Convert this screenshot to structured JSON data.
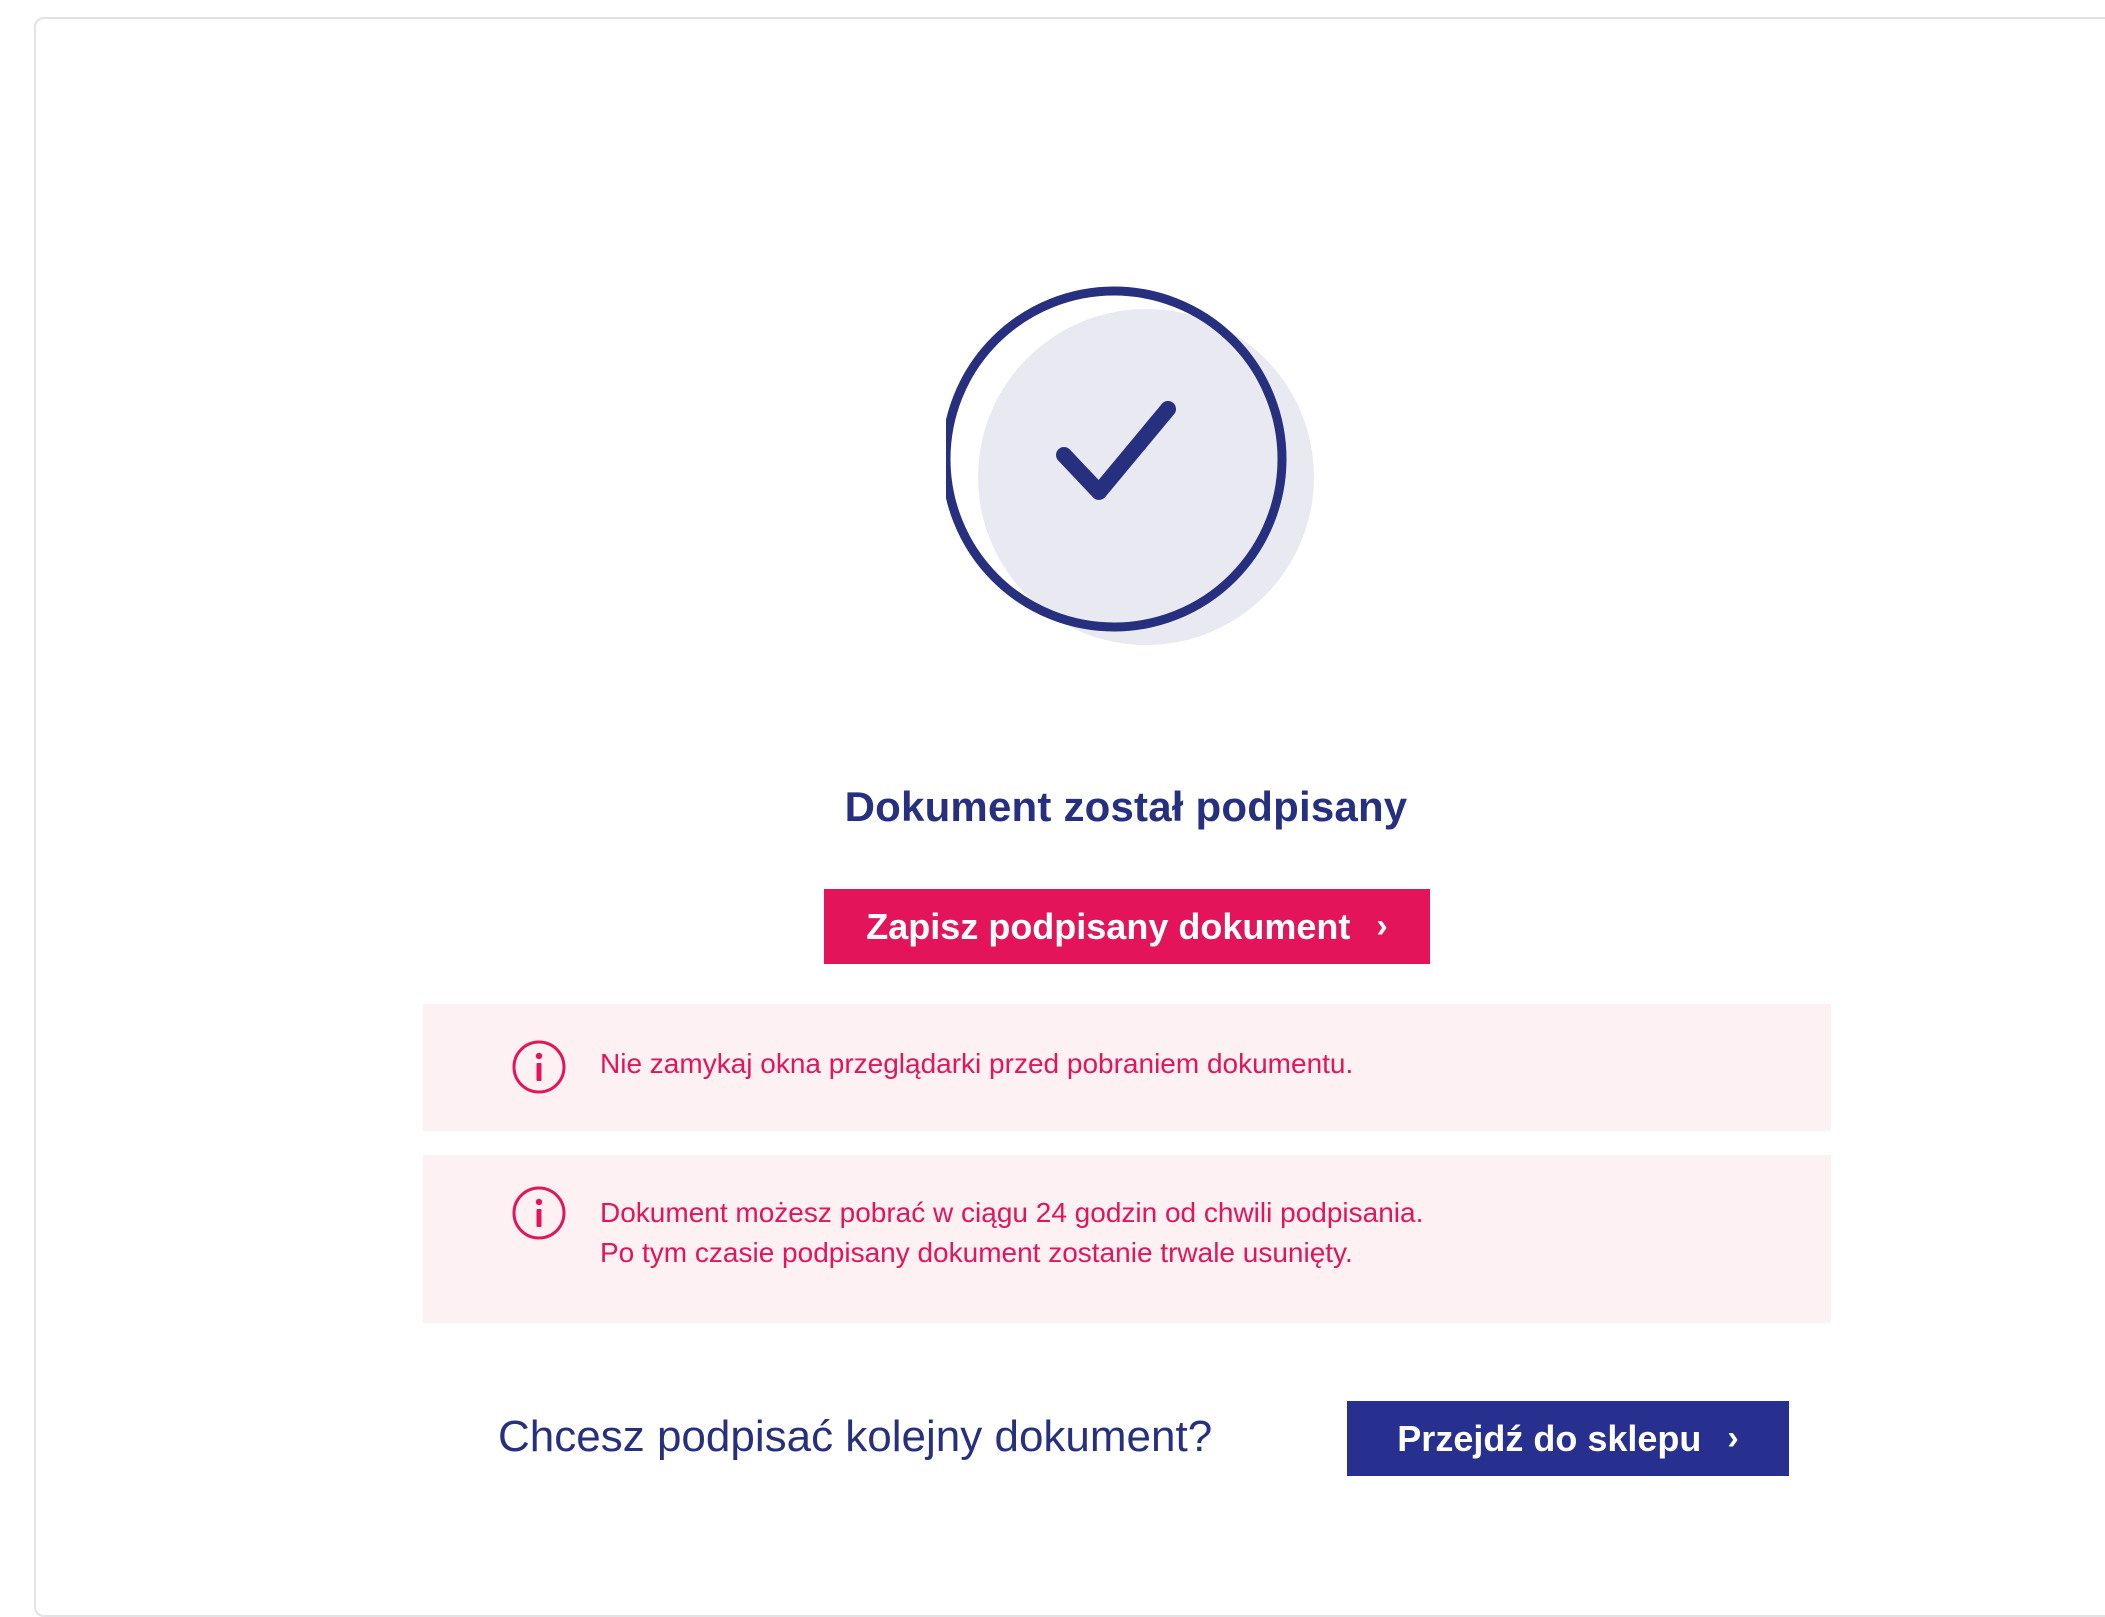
{
  "confirmation": {
    "title": "Dokument został podpisany",
    "save_button_label": "Zapisz podpisany dokument",
    "save_button_chevron": "›"
  },
  "notices": [
    {
      "icon": "info-circle-icon",
      "lines": [
        "Nie zamykaj okna przeglądarki przed pobraniem dokumentu."
      ]
    },
    {
      "icon": "info-circle-icon",
      "lines": [
        "Dokument możesz pobrać w ciągu 24 godzin od chwili podpisania.",
        "Po tym czasie podpisany dokument zostanie trwale usunięty."
      ]
    }
  ],
  "next_action": {
    "prompt": "Chcesz podpisać kolejny dokument?",
    "shop_button_label": "Przejdź do sklepu",
    "shop_button_chevron": "›"
  },
  "colors": {
    "primary_navy": "#27307f",
    "accent_pink": "#e3145a",
    "notice_background": "#fdf1f4",
    "circle_fill": "#e9eaf1"
  }
}
